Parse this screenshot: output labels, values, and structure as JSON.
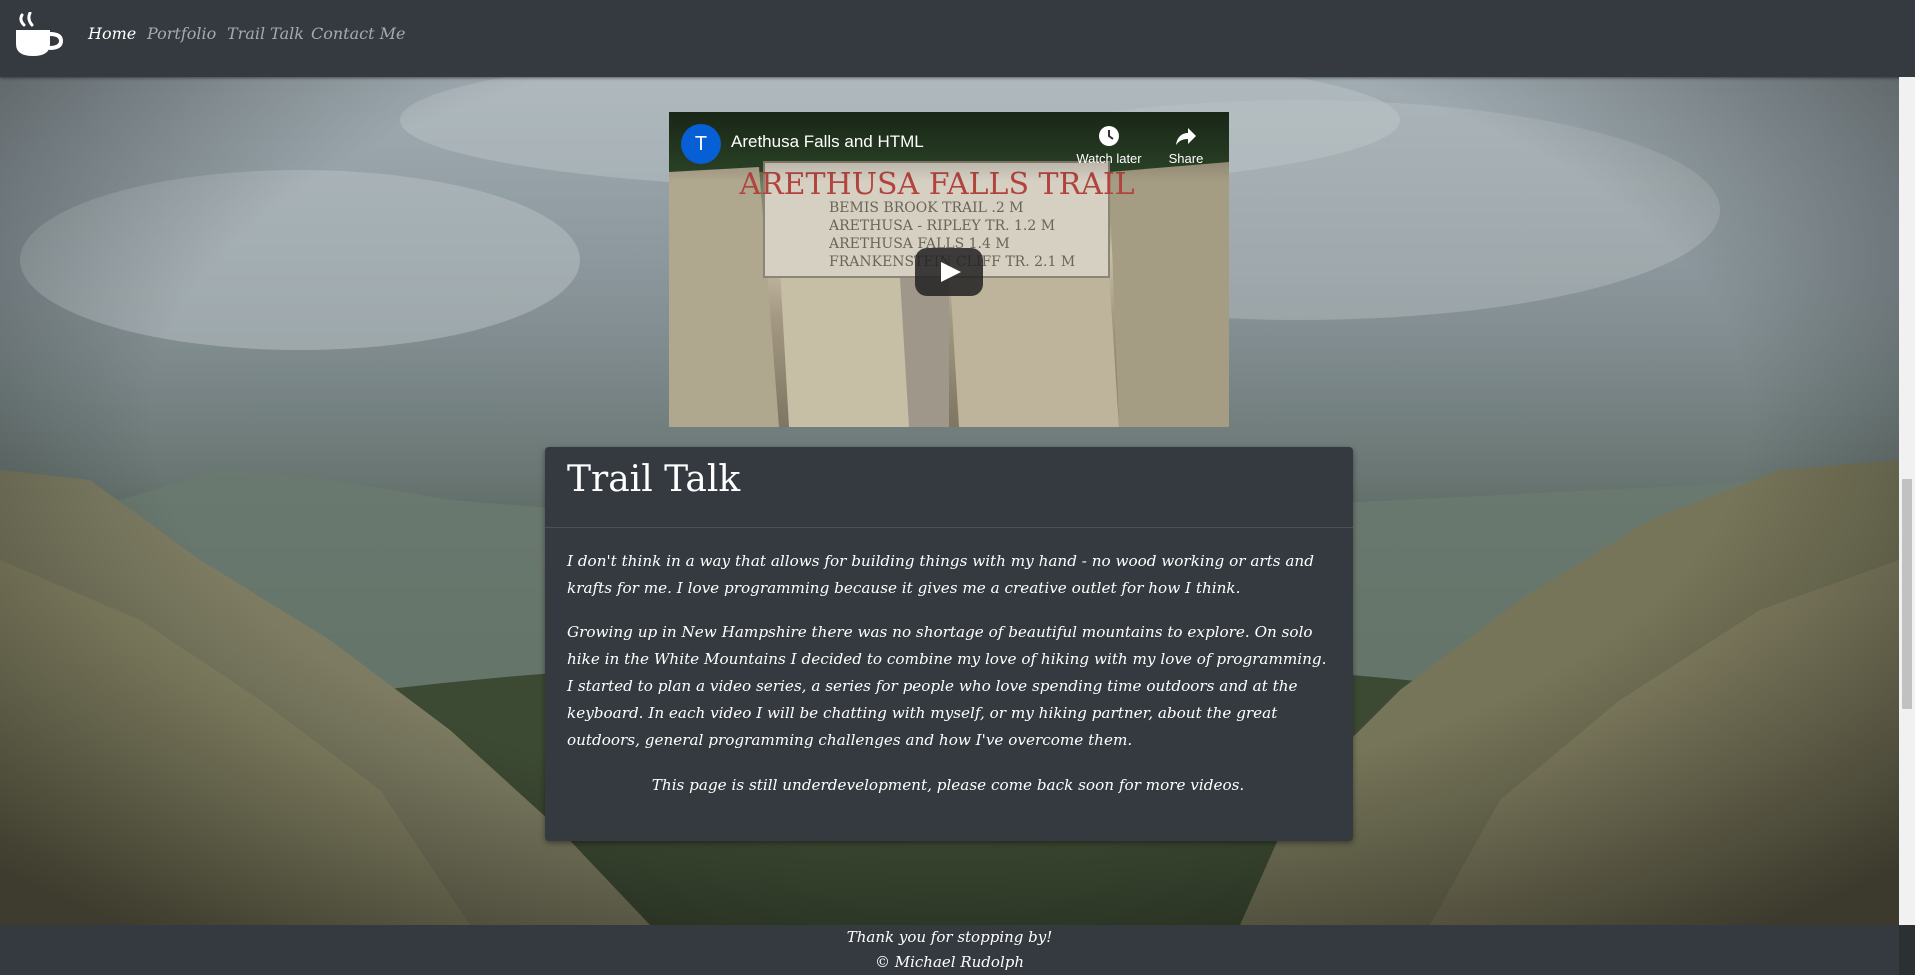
{
  "nav": {
    "logo_icon": "coffee-cup-icon",
    "links": [
      {
        "label": "Home",
        "active": true
      },
      {
        "label": "Portfolio",
        "active": false
      },
      {
        "label": "Trail Talk",
        "active": false
      },
      {
        "label": "Contact Me",
        "active": false
      }
    ]
  },
  "video": {
    "channel_initial": "T",
    "title": "Arethusa Falls and HTML",
    "watch_later_label": "Watch later",
    "share_label": "Share",
    "sign": {
      "heading": "ARETHUSA FALLS TRAIL",
      "lines": [
        "BEMIS BROOK TRAIL .2 M",
        "ARETHUSA - RIPLEY TR. 1.2 M",
        "ARETHUSA FALLS 1.4 M",
        "FRANKENSTEIN CLIFF TR. 2.1 M"
      ]
    }
  },
  "card": {
    "title": "Trail Talk",
    "paragraphs": [
      "I don't think in a way that allows for building things with my hand - no wood working or arts and krafts for me. I love programming because it gives me a creative outlet for how I think.",
      "Growing up in New Hampshire there was no shortage of beautiful mountains to explore. On solo hike in the White Mountains I decided to combine my love of hiking with my love of programming. I started to plan a video series, a series for people who love spending time outdoors and at the keyboard. In each video I will be chatting with myself, or my hiking partner, about the great outdoors, general programming challenges and how I've overcome them."
    ],
    "note": "This page is still underdevelopment, please come back soon for more videos."
  },
  "footer": {
    "thanks": "Thank you for stopping by!",
    "copyright": "© Michael Rudolph"
  },
  "colors": {
    "navbar": "#343a40",
    "card": "#343a40",
    "nav_inactive": "#a7aaad",
    "nav_active": "#ffffff",
    "youtube_blue": "#065fd4"
  }
}
